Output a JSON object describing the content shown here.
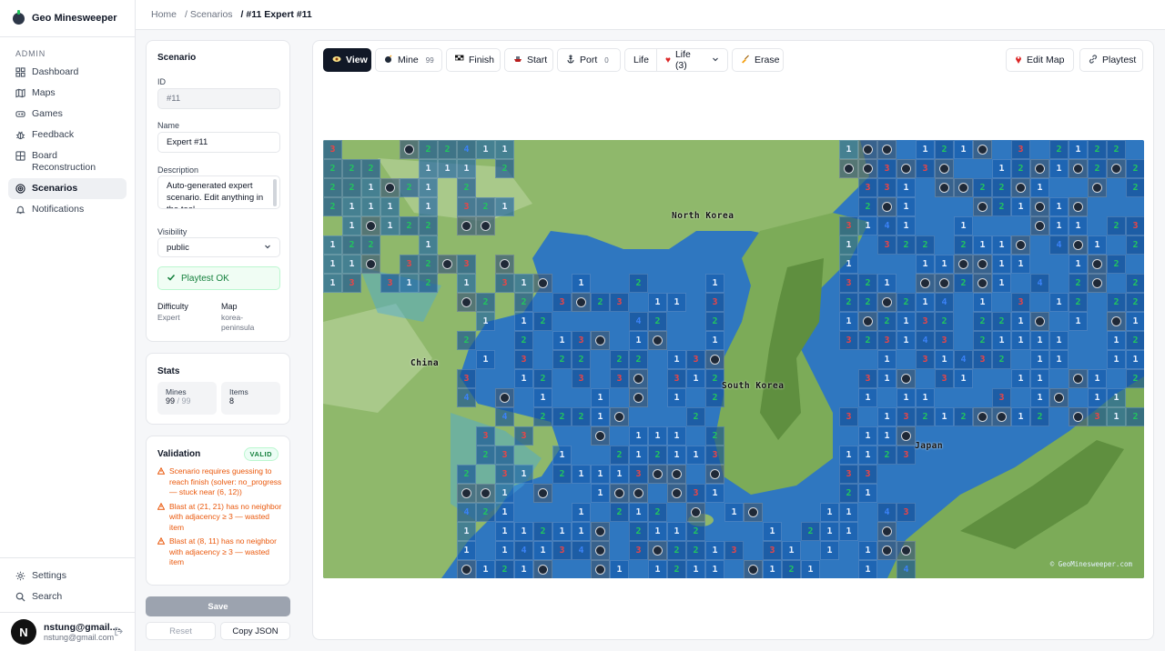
{
  "app": {
    "name": "Geo Minesweeper"
  },
  "breadcrumb": {
    "home": "Home",
    "scenarios": "/ Scenarios",
    "current": "/ #11 Expert #11"
  },
  "sidebar": {
    "section": "ADMIN",
    "items": [
      {
        "label": "Dashboard",
        "icon": "grid-icon"
      },
      {
        "label": "Maps",
        "icon": "map-icon"
      },
      {
        "label": "Games",
        "icon": "gamepad-icon"
      },
      {
        "label": "Feedback",
        "icon": "bug-icon"
      },
      {
        "label": "Board Reconstruction",
        "icon": "board-icon"
      },
      {
        "label": "Scenarios",
        "icon": "target-icon",
        "active": true
      },
      {
        "label": "Notifications",
        "icon": "bell-icon"
      }
    ],
    "bottom": [
      {
        "label": "Settings",
        "icon": "gear-icon"
      },
      {
        "label": "Search",
        "icon": "search-icon"
      }
    ],
    "user": {
      "initial": "N",
      "name": "nstung@gmail....",
      "email": "nstung@gmail.com"
    }
  },
  "scenario": {
    "title": "Scenario",
    "id_label": "ID",
    "id_value": "#11",
    "name_label": "Name",
    "name_value": "Expert #11",
    "description_label": "Description",
    "description_value": "Auto-generated expert scenario. Edit anything in the tool...",
    "visibility_label": "Visibility",
    "visibility_value": "public",
    "playtest_status": "Playtest OK",
    "difficulty_label": "Difficulty",
    "difficulty_value": "Expert",
    "map_label": "Map",
    "map_value": "korea-peninsula"
  },
  "stats": {
    "title": "Stats",
    "mines_label": "Mines",
    "mines_value": "99",
    "mines_total": "/ 99",
    "items_label": "Items",
    "items_value": "8"
  },
  "validation": {
    "title": "Validation",
    "badge": "VALID",
    "warnings": [
      "Scenario requires guessing to reach finish (solver: no_progress — stuck near (6, 12))",
      "Blast at (21, 21) has no neighbor with adjacency ≥ 3 — wasted item",
      "Blast at (8, 11) has no neighbor with adjacency ≥ 3 — wasted item"
    ]
  },
  "actions": {
    "save": "Save",
    "reset": "Reset",
    "copy_json": "Copy JSON"
  },
  "toolbar": {
    "view": "View",
    "mine": "Mine",
    "mine_count": "99",
    "finish": "Finish",
    "start": "Start",
    "port": "Port",
    "port_count": "0",
    "life": "Life",
    "life_select": "Life (3)",
    "erase": "Erase",
    "edit_map": "Edit Map",
    "playtest": "Playtest"
  },
  "map": {
    "labels": {
      "north_korea": "North Korea",
      "south_korea": "South Korea",
      "china": "China",
      "japan": "Japan"
    },
    "copyright": "© GeoMinesweeper.com",
    "colors": {
      "sea": "#2f77c0",
      "land": "#8fb86b",
      "mountain": "#5f8f3f",
      "shallow": "#49a8dc"
    }
  }
}
